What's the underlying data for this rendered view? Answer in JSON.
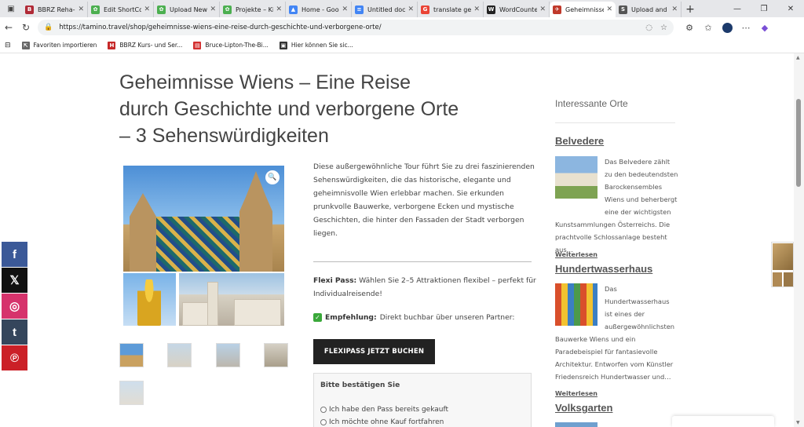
{
  "browser": {
    "tabs": [
      {
        "title": "BBRZ Reha-G",
        "color": "#b02a37",
        "glyph": "B"
      },
      {
        "title": "Edit ShortCo",
        "color": "#4caf50",
        "glyph": "✿"
      },
      {
        "title": "Upload New",
        "color": "#4caf50",
        "glyph": "✿"
      },
      {
        "title": "Projekte – Ki",
        "color": "#4caf50",
        "glyph": "✿"
      },
      {
        "title": "Home - Goo",
        "color": "#4285f4",
        "glyph": "▲"
      },
      {
        "title": "Untitled doc",
        "color": "#4285f4",
        "glyph": "≡"
      },
      {
        "title": "translate ge",
        "color": "#ea4335",
        "glyph": "G"
      },
      {
        "title": "WordCounte",
        "color": "#222222",
        "glyph": "W"
      },
      {
        "title": "Geheimnisse",
        "color": "#c0392b",
        "glyph": "✈"
      },
      {
        "title": "Upload and",
        "color": "#555555",
        "glyph": "S"
      }
    ],
    "active_tab_index": 8,
    "url": "https://tamino.travel/shop/geheimnisse-wiens-eine-reise-durch-geschichte-und-verborgene-orte/",
    "bookmarks": [
      {
        "label": "Favoriten importieren",
        "color": "#666666",
        "glyph": "⇱"
      },
      {
        "label": "BBRZ Kurs- und Ser...",
        "color": "#c62828",
        "glyph": "H"
      },
      {
        "label": "Bruce-Lipton-The-Bi...",
        "color": "#d32f2f",
        "glyph": "▤"
      },
      {
        "label": "Hier können Sie sic...",
        "color": "#333333",
        "glyph": "▣"
      }
    ]
  },
  "product": {
    "title": "Geheimnisse Wiens – Eine Reise durch Geschichte und verborgene Orte – 3 Sehenswürdigkeiten",
    "description": "Diese außergewöhnliche Tour führt Sie zu drei faszinierenden Sehenswürdigkeiten, die das historische, elegante und geheimnisvolle Wien erlebbar machen. Sie erkunden prunkvolle Bauwerke, verborgene Ecken und mystische Geschichten, die hinter den Fassaden der Stadt verborgen liegen.",
    "flexi_label": "Flexi Pass:",
    "flexi_text": "Wählen Sie 2–5 Attraktionen flexibel – perfekt für Individualreisende!",
    "empfehlung_label": "Empfehlung:",
    "empfehlung_text": "Direkt buchbar über unseren Partner:",
    "buy_button": "FLEXIPASS JETZT BUCHEN",
    "confirm_title": "Bitte bestätigen Sie",
    "radio_1": "Ich habe den Pass bereits gekauft",
    "radio_2": "Ich möchte ohne Kauf fortfahren"
  },
  "sidebar": {
    "heading": "Interessante Orte",
    "posts": [
      {
        "title": "Belvedere",
        "text": "Das Belvedere zählt zu den bedeutendsten Barockensembles Wiens und beherbergt eine der wichtigsten Kunstsammlungen Österreichs. Die prachtvolle Schlossanlage besteht aus…",
        "more": "Weiterlesen"
      },
      {
        "title": "Hundertwasserhaus",
        "text": "Das Hundertwasserhaus ist eines der außergewöhnlichsten Bauwerke Wiens und ein Paradebeispiel für fantasievolle Architektur. Entworfen vom Künstler Friedensreich Hundertwasser und…",
        "more": "Weiterlesen"
      },
      {
        "title": "Volksgarten"
      }
    ]
  },
  "social": [
    {
      "name": "facebook",
      "glyph": "f",
      "color": "#3b5998"
    },
    {
      "name": "x",
      "glyph": "𝕏",
      "color": "#111111"
    },
    {
      "name": "instagram",
      "glyph": "◎",
      "color": "#d6336c"
    },
    {
      "name": "tumblr",
      "glyph": "t",
      "color": "#35465c"
    },
    {
      "name": "pinterest",
      "glyph": "℗",
      "color": "#cb2027"
    }
  ]
}
